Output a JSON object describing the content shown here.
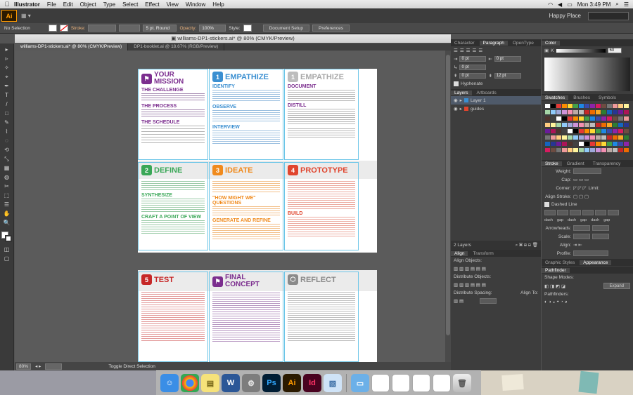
{
  "menubar": {
    "app": "Illustrator",
    "items": [
      "File",
      "Edit",
      "Object",
      "Type",
      "Select",
      "Effect",
      "View",
      "Window",
      "Help"
    ],
    "clock": "Mon 3:49 PM"
  },
  "appbar": {
    "logo": "Ai",
    "workspace": "Happy Place"
  },
  "control": {
    "selection": "No Selection",
    "stroke_label": "Stroke:",
    "brush": "5 pt. Round",
    "opacity_label": "Opacity:",
    "opacity": "100%",
    "style_label": "Style:",
    "doc_setup": "Document Setup",
    "preferences": "Preferences"
  },
  "window_title": "williams-DP1-stickers.ai* @ 80% (CMYK/Preview)",
  "tabs": [
    {
      "label": "williams-DP1-stickers.ai* @ 80% (CMYK/Preview)"
    },
    {
      "label": "DP1-booklet.ai @ 18.67% (RGB/Preview)"
    }
  ],
  "status": {
    "zoom": "80%",
    "tool": "Toggle Direct Selection"
  },
  "tools": [
    "▸",
    "▹",
    "✧",
    "⌖",
    "✒",
    "T",
    "/",
    "□",
    "✎",
    "⌇",
    "◌",
    "⟲",
    "⤡",
    "▦",
    "◍",
    "✂",
    "⬚",
    "☰",
    "✋",
    "🔍"
  ],
  "artboard1": {
    "mission_title": "YOUR MISSION",
    "challenge_head": "THE CHALLENGE",
    "process_head": "THE PROCESS",
    "schedule_head": "THE SCHEDULE",
    "empathize": {
      "num": "1",
      "title": "EMPATHIZE",
      "sections": [
        "IDENTIFY",
        "OBSERVE",
        "INTERVIEW"
      ]
    },
    "empathize2": {
      "num": "1",
      "title": "EMPATHIZE",
      "sections": [
        "DOCUMENT",
        "DISTILL"
      ]
    },
    "define": {
      "num": "2",
      "title": "DEFINE",
      "sections": [
        "SYNTHESIZE",
        "CRAFT A POINT OF VIEW"
      ]
    },
    "ideate": {
      "num": "3",
      "title": "IDEATE",
      "sections": [
        "\"HOW MIGHT WE\" QUESTIONS",
        "GENERATE AND REFINE"
      ]
    },
    "prototype": {
      "num": "4",
      "title": "PROTOTYPE",
      "sections": [
        "BUILD"
      ]
    }
  },
  "artboard2": {
    "test": {
      "num": "5",
      "title": "TEST"
    },
    "final": {
      "title": "FINAL CONCEPT"
    },
    "reflect": {
      "title": "REFLECT"
    }
  },
  "panels": {
    "char_tabs": [
      "Character",
      "Paragraph",
      "OpenType"
    ],
    "para_values": [
      "0 pt",
      "0 pt",
      "0 pt",
      "0 pt",
      "12 pt"
    ],
    "hyphenate": "Hyphenate",
    "layers_tabs": [
      "Layers",
      "Artboards"
    ],
    "layers": [
      "Layer 1",
      "guides"
    ],
    "layers_count": "2 Layers",
    "align_tabs": [
      "Align",
      "Transform"
    ],
    "align_labels": [
      "Align Objects:",
      "Distribute Objects:",
      "Distribute Spacing:",
      "Align To:"
    ],
    "color_tab": "Color",
    "k_label": "K",
    "k_value": "60",
    "swatch_tabs": [
      "Swatches",
      "Brushes",
      "Symbols"
    ],
    "stroke_tabs": [
      "Stroke",
      "Gradient",
      "Transparency"
    ],
    "stroke_labels": [
      "Weight:",
      "Cap:",
      "Corner:",
      "Limit:",
      "Align Stroke:",
      "Dashed Line",
      "Arrowheads:",
      "Scale:",
      "Align:",
      "Profile:"
    ],
    "dash_labels": [
      "dash",
      "gap",
      "dash",
      "gap",
      "dash",
      "gap"
    ],
    "appearance_tabs": [
      "Graphic Styles",
      "Appearance"
    ],
    "pathfinder": "Pathfinder",
    "shape_modes": "Shape Modes:",
    "expand": "Expand",
    "pathfinders": "Pathfinders:"
  },
  "dock": [
    "Finder",
    "Chrome",
    "Stickies",
    "Word",
    "System Preferences",
    "Ps",
    "Ai",
    "Id",
    "Preview",
    "Downloads",
    "Screenshot",
    "Screenshot",
    "Screenshot",
    "Screenshot",
    "Trash"
  ],
  "colors": {
    "purple": "#7b2d8e",
    "blue": "#3b8fd1",
    "gray": "#9a9a9a",
    "green": "#3aa757",
    "orange": "#f08a1c",
    "red": "#e0452e",
    "ai_orange": "#ff9a00"
  }
}
